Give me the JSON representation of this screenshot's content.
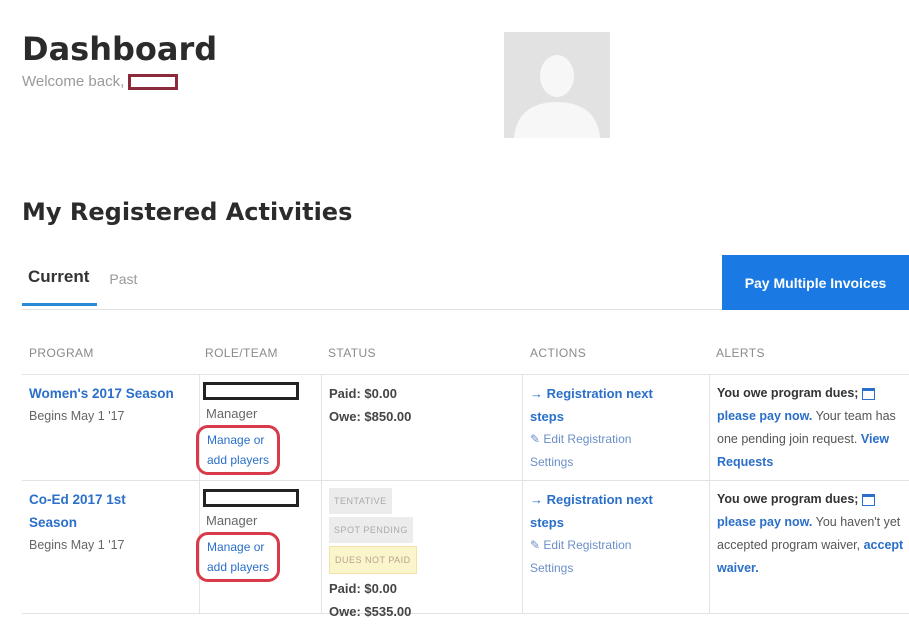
{
  "header": {
    "title": "Dashboard",
    "welcome": "Welcome back,"
  },
  "section_title": "My Registered Activities",
  "tabs": [
    {
      "label": "Current",
      "active": true
    },
    {
      "label": "Past",
      "active": false
    }
  ],
  "pay_button": "Pay Multiple Invoices",
  "columns": [
    "PROGRAM",
    "ROLE/TEAM",
    "STATUS",
    "ACTIONS",
    "ALERTS"
  ],
  "rows": [
    {
      "program": "Women's 2017 Season",
      "begins": "Begins May 1 '17",
      "role": "Manager",
      "manage": [
        "Manage or",
        "add players"
      ],
      "badges": [],
      "paid": "Paid: $0.00",
      "owe": "Owe: $850.00",
      "action_main": [
        "→ Registration next",
        "steps"
      ],
      "action_sub": [
        "Edit Registration",
        "Settings"
      ],
      "alert": {
        "lead": "You owe program dues;",
        "pay_link": "please pay now.",
        "text": " Your team has one pending join request. ",
        "link2": "View Requests"
      }
    },
    {
      "program": "Co-Ed 2017 1st Season",
      "begins": "Begins May 1 '17",
      "role": "Manager",
      "manage": [
        "Manage or",
        "add players"
      ],
      "badges": [
        "TENTATIVE",
        "SPOT PENDING",
        "DUES NOT PAID"
      ],
      "paid": "Paid: $0.00",
      "owe": "Owe: $535.00",
      "action_main": [
        "→ Registration next",
        "steps"
      ],
      "action_sub": [
        "Edit Registration",
        "Settings"
      ],
      "alert": {
        "lead": "You owe program dues;",
        "pay_link": "please pay now.",
        "text": " You haven't yet accepted program waiver, ",
        "link2": "accept waiver."
      }
    }
  ],
  "colors": {
    "accent": "#1a79e3",
    "link": "#2a6fc9",
    "annotation": "#d93a4a",
    "tab_underline": "#2a8ad6"
  },
  "icons": [
    "user-avatar-icon",
    "arrow-right-icon",
    "edit-icon",
    "credit-card-icon"
  ]
}
